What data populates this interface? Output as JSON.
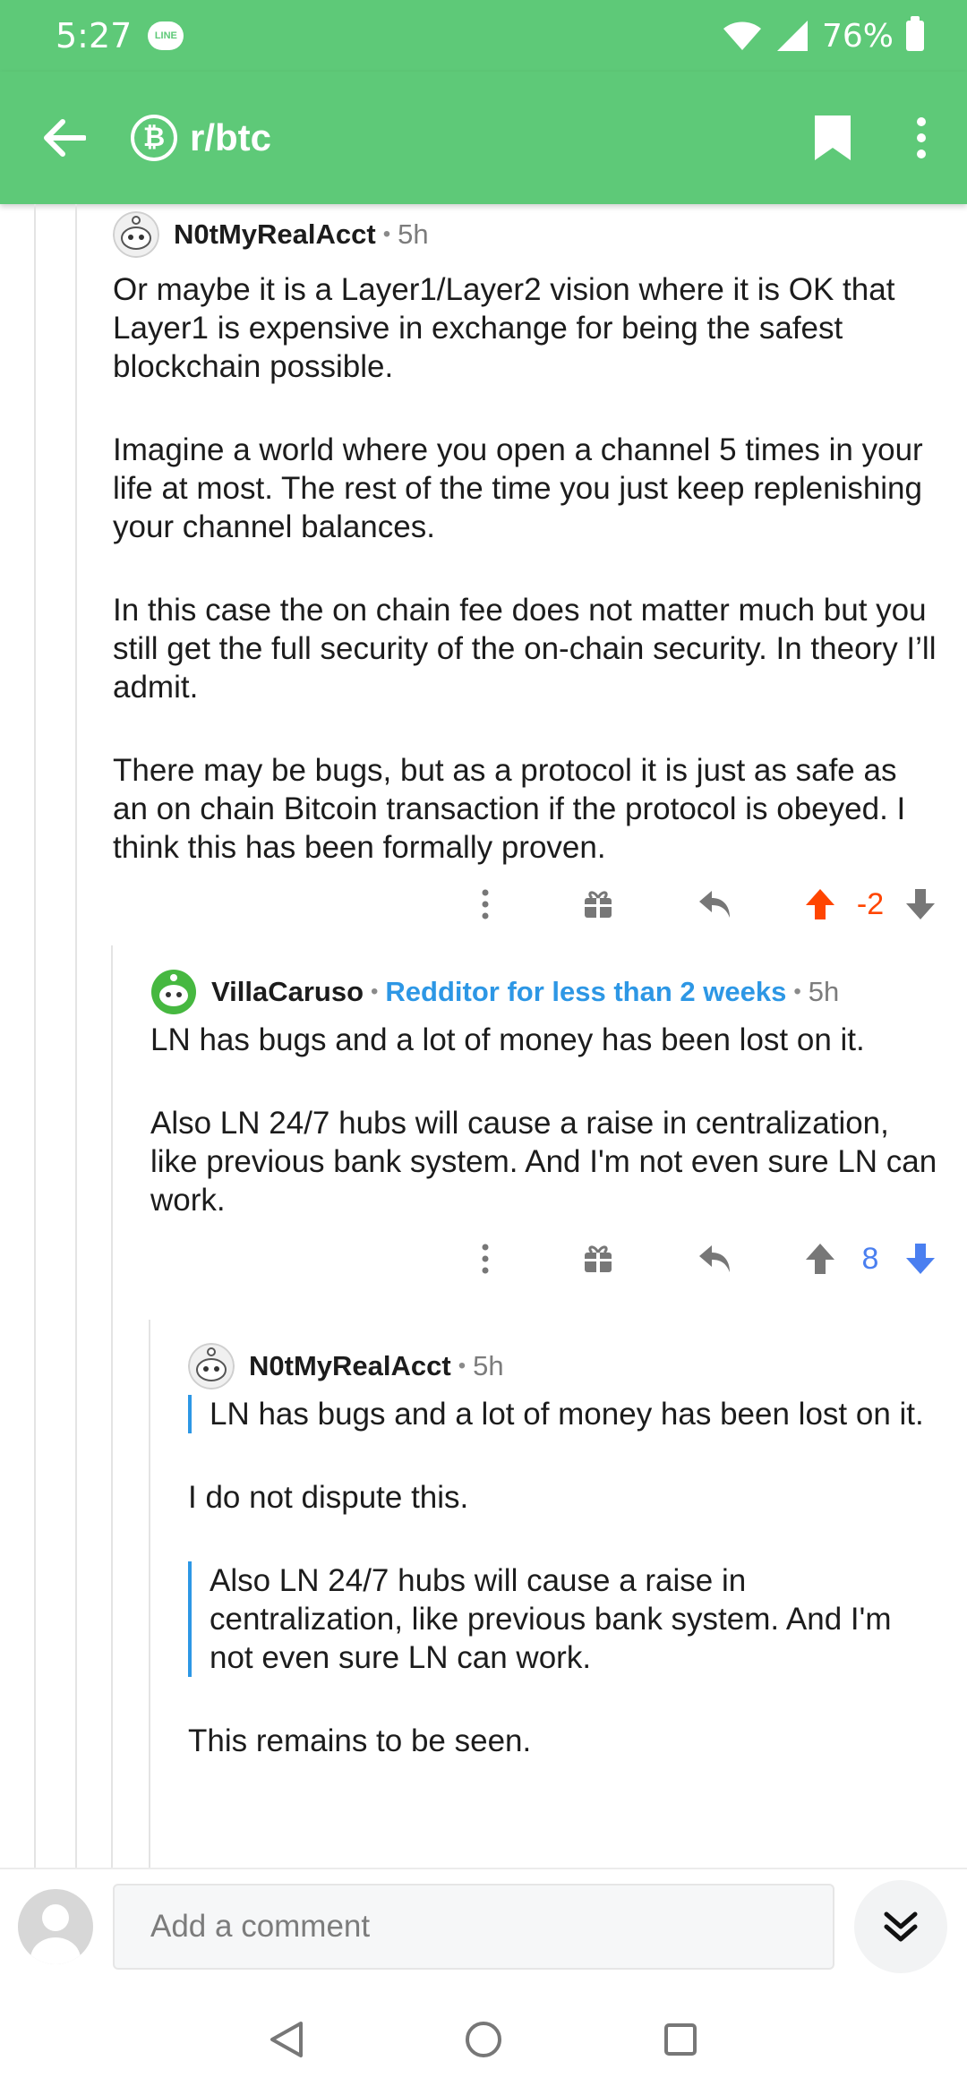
{
  "status_bar": {
    "time": "5:27",
    "notification_badge": "LINE",
    "battery": "76%",
    "icons": [
      "wifi-icon",
      "signal-icon",
      "battery-icon"
    ]
  },
  "app_bar": {
    "subreddit": "r/btc",
    "sub_icon_glyph": "₿",
    "icons": [
      "back-arrow-icon",
      "bitcoin-icon",
      "bookmark-icon",
      "overflow-menu-icon"
    ]
  },
  "colors": {
    "brand_green": "#5ec978",
    "upvote_active": "#ff4500",
    "downvote_active": "#4a7ff0",
    "flair_blue": "#2d97e5",
    "quote_bar": "#2d97e5"
  },
  "comments": [
    {
      "author": "N0tMyRealAcct",
      "age": "5h",
      "paragraphs": [
        "Or maybe it is a Layer1/Layer2 vision where it is OK that Layer1 is expensive in exchange for being the safest blockchain possible.",
        "Imagine a world where you open a channel 5 times in your life at most. The rest of the time you just keep replenishing your channel balances.",
        "In this case the on chain fee does not matter much but you still get the full security of the on-chain security. In theory I’ll admit.",
        "There may be bugs, but as a protocol it is just as safe as an on chain Bitcoin transaction if the protocol is obeyed. I think this has been formally proven."
      ],
      "score": "-2",
      "vote_state": "upvoted"
    },
    {
      "author": "VillaCaruso",
      "flair": "Redditor for less than 2 weeks",
      "age": "5h",
      "paragraphs": [
        "LN has bugs and a lot of money has been lost on it.",
        "Also LN 24/7 hubs will cause a raise in centralization, like previous bank system. And I'm not even sure LN can work."
      ],
      "score": "8",
      "vote_state": "downvoted"
    },
    {
      "author": "N0tMyRealAcct",
      "age": "5h",
      "quote1": "LN has bugs and a lot of money has been lost on it.",
      "text1": "I do not dispute this.",
      "quote2": "Also LN 24/7 hubs will cause a raise in centralization, like previous bank system. And I'm not even sure LN can work.",
      "text2": "This remains to be seen."
    }
  ],
  "composer": {
    "placeholder": "Add a comment"
  },
  "nav_bar": {
    "buttons": [
      "back",
      "home",
      "recents"
    ]
  }
}
